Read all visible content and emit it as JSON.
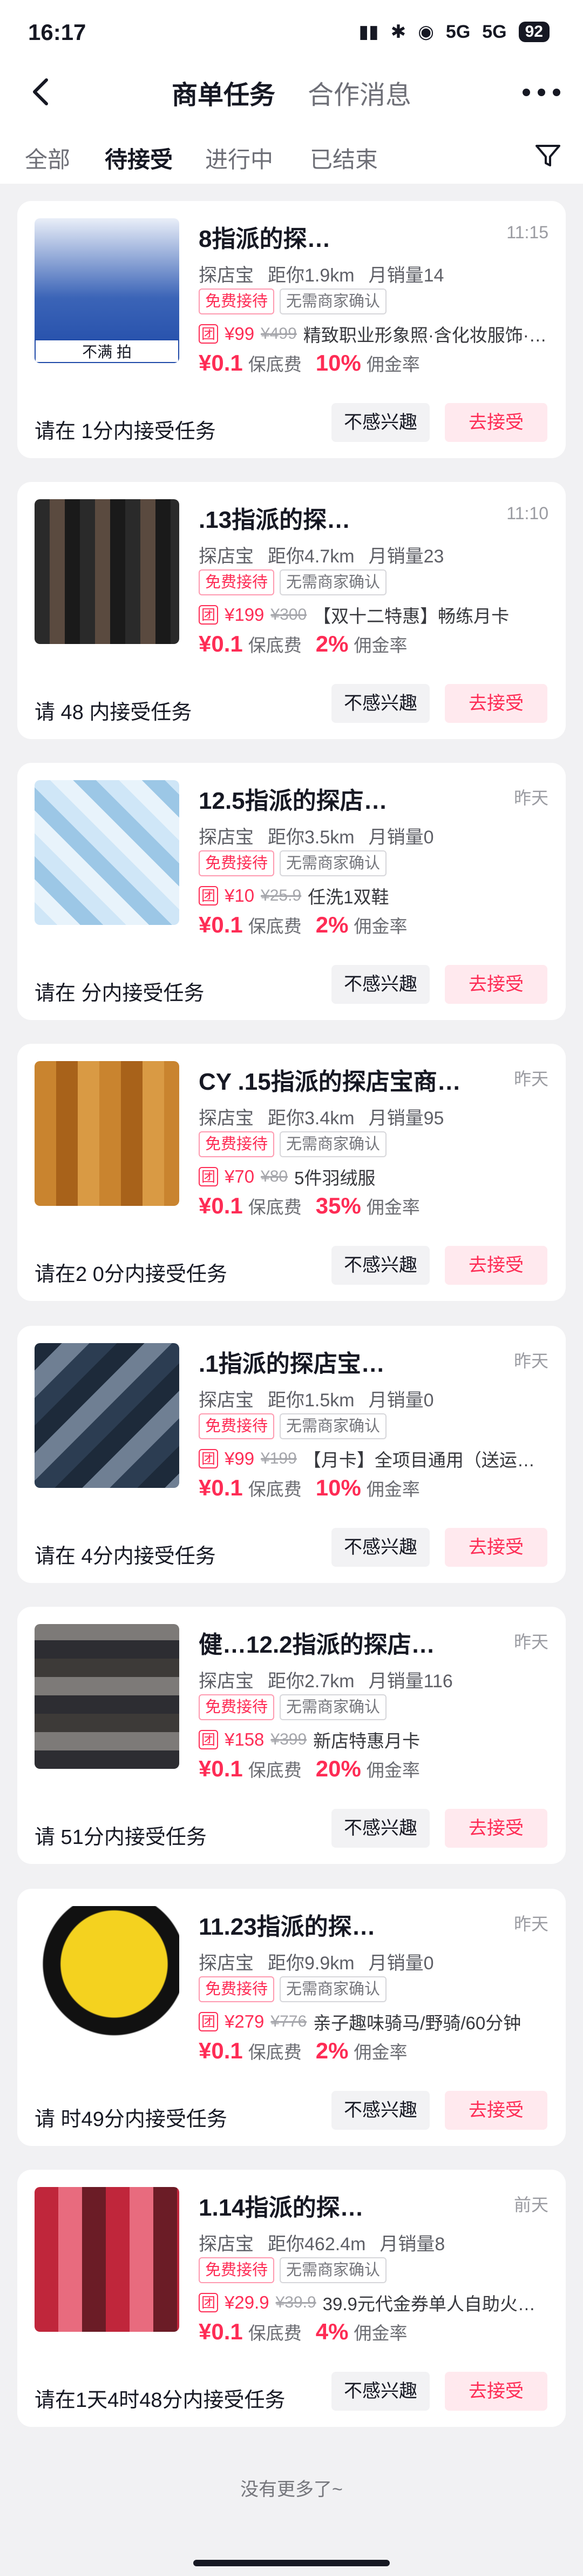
{
  "status_bar": {
    "time": "16:17",
    "signal_1": "5G",
    "signal_2": "5G",
    "battery": "92"
  },
  "header": {
    "tabs": [
      "商单任务",
      "合作消息"
    ],
    "active_tab": 0
  },
  "filters": {
    "tabs": [
      "全部",
      "待接受",
      "进行中",
      "已结束"
    ],
    "active": 1
  },
  "colors": {
    "accent": "#fe2c55",
    "accent_light": "#ffe9ee",
    "background": "#f1f1f3"
  },
  "tasks": [
    {
      "title": "8指派的探…",
      "time": "11:15",
      "thumb_label": "不满 拍",
      "platform": "探店宝",
      "distance": "距你1.9km",
      "sales": "月销量14",
      "tag_free": "免费接待",
      "tag_confirm": "无需商家确认",
      "deal_badge": "团",
      "price": "¥99",
      "orig_price": "¥499",
      "deal": "精致职业形象照·含化妆服饰·…",
      "fee": "¥0.1",
      "fee_label": "保底费",
      "commission": "10%",
      "commission_label": "佣金率",
      "deadline": "请在 1分内接受任务",
      "skip": "不感兴趣",
      "accept": "去接受"
    },
    {
      "title": ".13指派的探…",
      "time": "11:10",
      "thumb_label": "",
      "platform": "探店宝",
      "distance": "距你4.7km",
      "sales": "月销量23",
      "tag_free": "免费接待",
      "tag_confirm": "无需商家确认",
      "deal_badge": "团",
      "price": "¥199",
      "orig_price": "¥300",
      "deal": "【双十二特惠】畅练月卡",
      "fee": "¥0.1",
      "fee_label": "保底费",
      "commission": "2%",
      "commission_label": "佣金率",
      "deadline": "请 48 内接受任务",
      "skip": "不感兴趣",
      "accept": "去接受"
    },
    {
      "title": "12.5指派的探店…",
      "time": "昨天",
      "thumb_label": "",
      "platform": "探店宝",
      "distance": "距你3.5km",
      "sales": "月销量0",
      "tag_free": "免费接待",
      "tag_confirm": "无需商家确认",
      "deal_badge": "团",
      "price": "¥10",
      "orig_price": "¥25.9",
      "deal": "任洗1双鞋",
      "fee": "¥0.1",
      "fee_label": "保底费",
      "commission": "2%",
      "commission_label": "佣金率",
      "deadline": "请在 分内接受任务",
      "skip": "不感兴趣",
      "accept": "去接受"
    },
    {
      "title": "CY .15指派的探店宝商…",
      "time": "昨天",
      "thumb_label": "",
      "platform": "探店宝",
      "distance": "距你3.4km",
      "sales": "月销量95",
      "tag_free": "免费接待",
      "tag_confirm": "无需商家确认",
      "deal_badge": "团",
      "price": "¥70",
      "orig_price": "¥80",
      "deal": "5件羽绒服",
      "fee": "¥0.1",
      "fee_label": "保底费",
      "commission": "35%",
      "commission_label": "佣金率",
      "deadline": "请在2 0分内接受任务",
      "skip": "不感兴趣",
      "accept": "去接受"
    },
    {
      "title": ".1指派的探店宝…",
      "time": "昨天",
      "thumb_label": "",
      "platform": "探店宝",
      "distance": "距你1.5km",
      "sales": "月销量0",
      "tag_free": "免费接待",
      "tag_confirm": "无需商家确认",
      "deal_badge": "团",
      "price": "¥99",
      "orig_price": "¥199",
      "deal": "【月卡】全项目通用（送运…",
      "fee": "¥0.1",
      "fee_label": "保底费",
      "commission": "10%",
      "commission_label": "佣金率",
      "deadline": "请在 4分内接受任务",
      "skip": "不感兴趣",
      "accept": "去接受"
    },
    {
      "title": "健…12.2指派的探店…",
      "time": "昨天",
      "thumb_label": "",
      "platform": "探店宝",
      "distance": "距你2.7km",
      "sales": "月销量116",
      "tag_free": "免费接待",
      "tag_confirm": "无需商家确认",
      "deal_badge": "团",
      "price": "¥158",
      "orig_price": "¥399",
      "deal": "新店特惠月卡",
      "fee": "¥0.1",
      "fee_label": "保底费",
      "commission": "20%",
      "commission_label": "佣金率",
      "deadline": "请 51分内接受任务",
      "skip": "不感兴趣",
      "accept": "去接受"
    },
    {
      "title": "11.23指派的探…",
      "time": "昨天",
      "thumb_label": "",
      "platform": "探店宝",
      "distance": "距你9.9km",
      "sales": "月销量0",
      "tag_free": "免费接待",
      "tag_confirm": "无需商家确认",
      "deal_badge": "团",
      "price": "¥279",
      "orig_price": "¥776",
      "deal": "亲子趣味骑马/野骑/60分钟",
      "fee": "¥0.1",
      "fee_label": "保底费",
      "commission": "2%",
      "commission_label": "佣金率",
      "deadline": "请 时49分内接受任务",
      "skip": "不感兴趣",
      "accept": "去接受"
    },
    {
      "title": "1.14指派的探…",
      "time": "前天",
      "thumb_label": "",
      "platform": "探店宝",
      "distance": "距你462.4m",
      "sales": "月销量8",
      "tag_free": "免费接待",
      "tag_confirm": "无需商家确认",
      "deal_badge": "团",
      "price": "¥29.9",
      "orig_price": "¥39.9",
      "deal": "39.9元代金券单人自助火…",
      "fee": "¥0.1",
      "fee_label": "保底费",
      "commission": "4%",
      "commission_label": "佣金率",
      "deadline": "请在1天4时48分内接受任务",
      "skip": "不感兴趣",
      "accept": "去接受"
    }
  ],
  "footer": {
    "no_more": "没有更多了~"
  }
}
